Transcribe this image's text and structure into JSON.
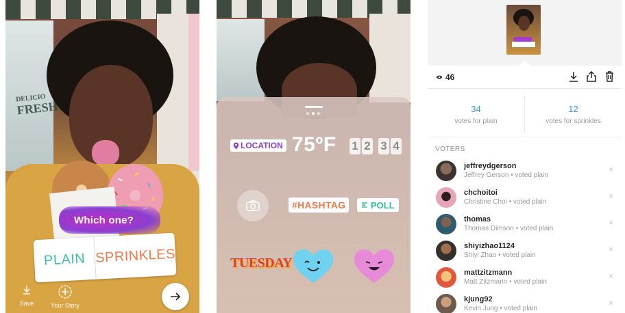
{
  "panel1": {
    "shop_sign": "FRESH PIES",
    "shop_sign_small": "DELICIO",
    "poll_question": "Which one?",
    "poll_option_1": "PLAIN",
    "poll_option_2": "SPRINKLES",
    "save_label": "Save",
    "your_story_label": "Your Story",
    "icons": [
      "download-icon",
      "add-story-icon",
      "arrow-right-icon"
    ]
  },
  "panel2": {
    "location_label": "LOCATION",
    "temperature": "75ºF",
    "clock_digits": [
      "1",
      "2",
      "3",
      "4"
    ],
    "hashtag_label": "#HASHTAG",
    "poll_label": "POLL",
    "day_label": "TUESDAY",
    "colors": {
      "location": "#8a3fd0",
      "hashtag": "#f07a4a",
      "poll": "#2cbf9a",
      "heart": "#6fd2f0",
      "heart_pink": "#e78ad8"
    }
  },
  "panel3": {
    "view_count": "46",
    "results": [
      {
        "count": "34",
        "label": "votes for plain"
      },
      {
        "count": "12",
        "label": "votes for sprinkles"
      }
    ],
    "voters_heading": "VOTERS",
    "voters": [
      {
        "username": "jeffreydgerson",
        "detail": "Jeffrey Gerson • voted plain"
      },
      {
        "username": "chchoitoi",
        "detail": "Christine Choi • voted plain"
      },
      {
        "username": "thomas",
        "detail": "Thomas Dimson • voted plain"
      },
      {
        "username": "shiyizhao1124",
        "detail": "Shiyi Zhao • voted plain"
      },
      {
        "username": "mattzitzmann",
        "detail": "Matt Zitzmann • voted plain"
      },
      {
        "username": "kjung92",
        "detail": "Kevin Jung • voted plain"
      }
    ],
    "remove_glyph": "×",
    "accent": "#3897f0"
  }
}
